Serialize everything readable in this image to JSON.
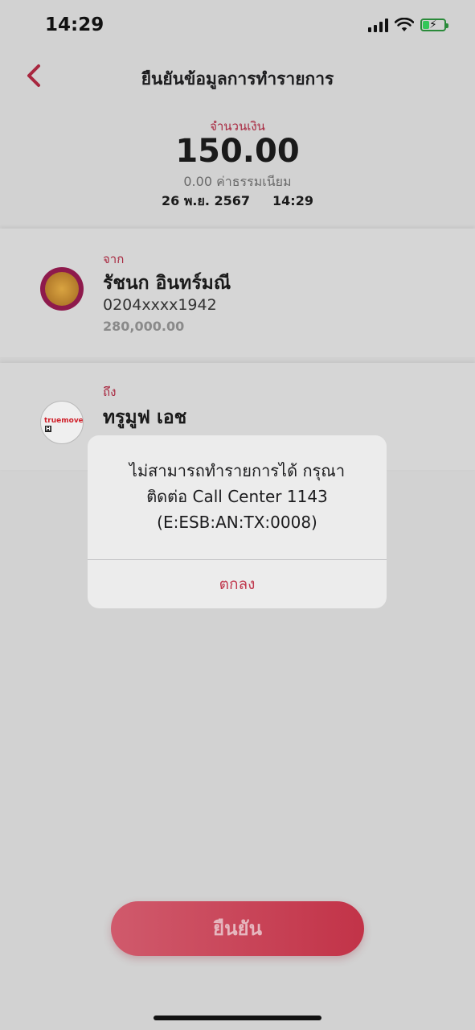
{
  "status_bar": {
    "time": "14:29"
  },
  "header": {
    "title": "ยืนยันข้อมูลการทำรายการ"
  },
  "summary": {
    "amount_label": "จำนวนเงิน",
    "amount": "150.00",
    "fee": "0.00 ค่าธรรมเนียม",
    "date": "26 พ.ย. 2567",
    "time": "14:29"
  },
  "from": {
    "label": "จาก",
    "name": "รัชนก อินทร์มณี",
    "account": "0204xxxx1942",
    "balance": "280,000.00"
  },
  "to": {
    "label": "ถึง",
    "name": "ทรูมูฟ เอช",
    "logo_text": "truemove",
    "logo_badge": "H"
  },
  "alert": {
    "message_lines": [
      "ไม่สามารถทำรายการได้ กรุณา",
      "ติดต่อ Call Center 1143",
      "(E:ESB:AN:TX:0008)"
    ],
    "ok_label": "ตกลง"
  },
  "confirm_button": {
    "label": "ยืนยัน"
  },
  "colors": {
    "accent": "#a8273f",
    "button": "#c23348",
    "overlay": "#d2d2d2"
  }
}
